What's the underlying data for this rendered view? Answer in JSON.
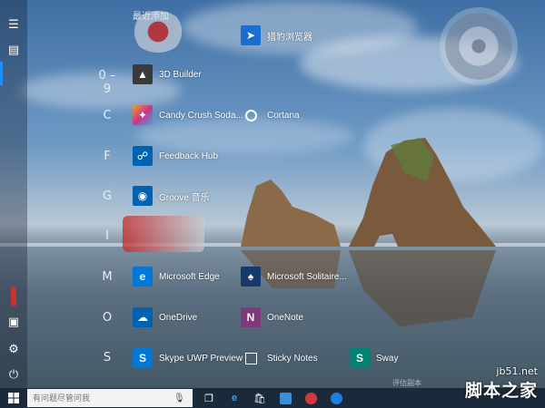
{
  "start_menu": {
    "recent_heading": "最近添加",
    "sections": [
      {
        "letter": "0 – 9"
      },
      {
        "letter": "C"
      },
      {
        "letter": "F"
      },
      {
        "letter": "G"
      },
      {
        "letter": "I"
      },
      {
        "letter": "M"
      },
      {
        "letter": "O"
      },
      {
        "letter": "S"
      }
    ],
    "apps": {
      "recent": {
        "label": "猎豹浏览器",
        "icon": "cheetah-browser-icon",
        "color": "#1a6ecf"
      },
      "builder3d": {
        "label": "3D Builder",
        "icon": "3d-builder-icon",
        "color": "#2a7fd4"
      },
      "candy": {
        "label": "Candy Crush Soda...",
        "icon": "candy-crush-icon",
        "color": "#c9348a"
      },
      "cortana": {
        "label": "Cortana",
        "icon": "cortana-icon",
        "color": "#0063b1"
      },
      "feedback": {
        "label": "Feedback Hub",
        "icon": "feedback-hub-icon",
        "color": "#0063b1"
      },
      "groove": {
        "label": "Groove 音乐",
        "icon": "groove-music-icon",
        "color": "#0063b1"
      },
      "edge": {
        "label": "Microsoft Edge",
        "icon": "edge-icon",
        "color": "#0078d7"
      },
      "solitaire": {
        "label": "Microsoft Solitaire...",
        "icon": "solitaire-icon",
        "color": "#15396b"
      },
      "onedrive": {
        "label": "OneDrive",
        "icon": "onedrive-icon",
        "color": "#0063b1"
      },
      "onenote": {
        "label": "OneNote",
        "icon": "onenote-icon",
        "color": "#80397b"
      },
      "skype": {
        "label": "Skype UWP Preview",
        "icon": "skype-icon",
        "color": "#0078d7"
      },
      "sticky": {
        "label": "Sticky Notes",
        "icon": "sticky-notes-icon",
        "color": "#0063b1"
      },
      "sway": {
        "label": "Sway",
        "icon": "sway-icon",
        "color": "#008272"
      }
    }
  },
  "rail": {
    "items": [
      "hamburger-menu-icon",
      "all-apps-icon",
      "user-icon",
      "documents-icon",
      "settings-icon",
      "power-icon"
    ]
  },
  "taskbar": {
    "search_placeholder": "有问题尽管问我",
    "icons": [
      "task-view-icon",
      "edge-icon",
      "store-icon",
      "app-icon",
      "app-icon-2",
      "app-icon-3"
    ]
  },
  "overlay": {
    "faded_text": "评估副本",
    "watermark_site": "jb51.net",
    "watermark_name": "脚本之家"
  }
}
